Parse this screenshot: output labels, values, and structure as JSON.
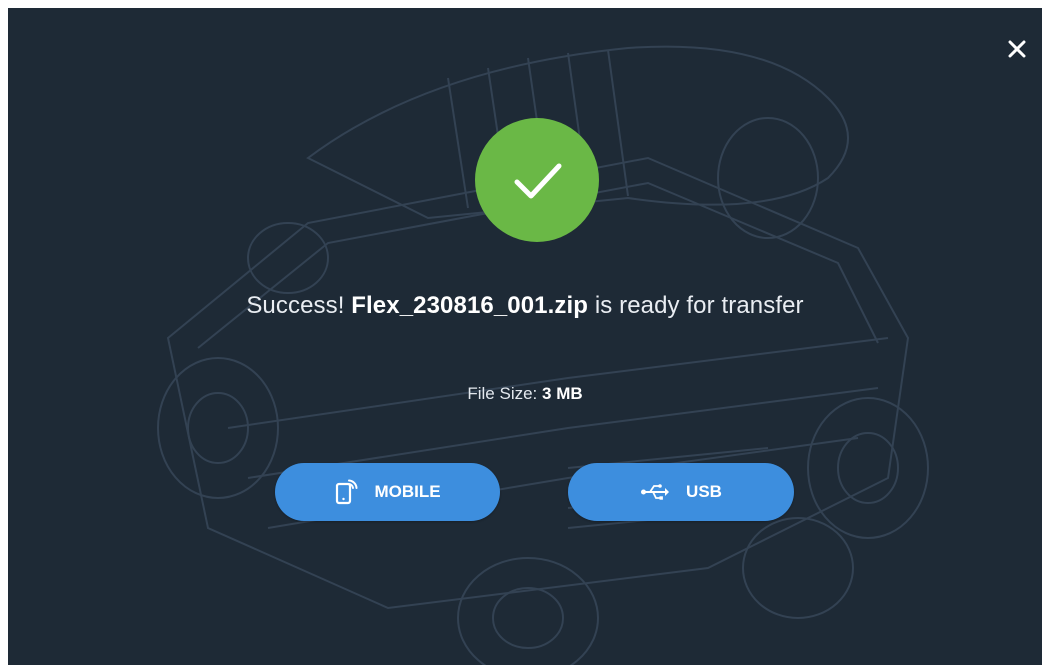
{
  "dialog": {
    "close_icon": "close-icon",
    "status_icon": "check-circle-icon",
    "message_prefix": "Success!",
    "file_name": "Flex_230816_001.zip",
    "message_suffix": "is ready for transfer",
    "file_size_label": "File Size:",
    "file_size_value": "3 MB"
  },
  "buttons": {
    "mobile": {
      "label": "MOBILE",
      "icon": "mobile-wireless-icon"
    },
    "usb": {
      "label": "USB",
      "icon": "usb-icon"
    }
  },
  "colors": {
    "background": "#1e2a36",
    "success": "#6ab846",
    "button": "#3d8ede",
    "text": "#ffffff"
  }
}
